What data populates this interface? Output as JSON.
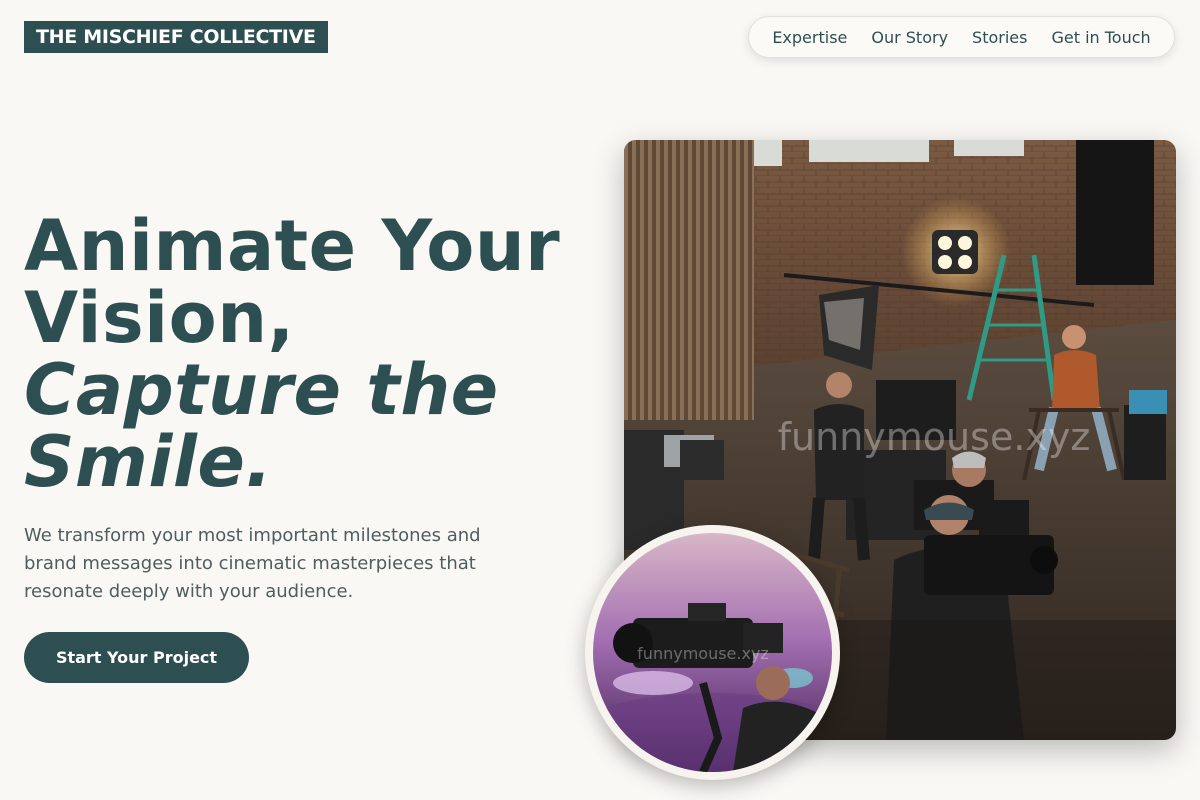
{
  "brand": {
    "logo_text": "THE MISCHIEF COLLECTIVE"
  },
  "nav": {
    "items": [
      {
        "label": "Expertise"
      },
      {
        "label": "Our Story"
      },
      {
        "label": "Stories"
      },
      {
        "label": "Get in Touch"
      }
    ]
  },
  "hero": {
    "title_line1": "Animate Your",
    "title_line2": "Vision,",
    "title_line3": "Capture the",
    "title_line4": "Smile.",
    "description": "We transform your most important milestones and brand messages into cinematic masterpieces that resonate deeply with your audience.",
    "cta_label": "Start Your Project"
  },
  "images": {
    "main_watermark": "funnymouse.xyz",
    "circle_watermark": "funnymouse.xyz"
  },
  "colors": {
    "primary": "#2e4f52",
    "background": "#faf8f5",
    "text_muted": "#4f5d5f"
  }
}
